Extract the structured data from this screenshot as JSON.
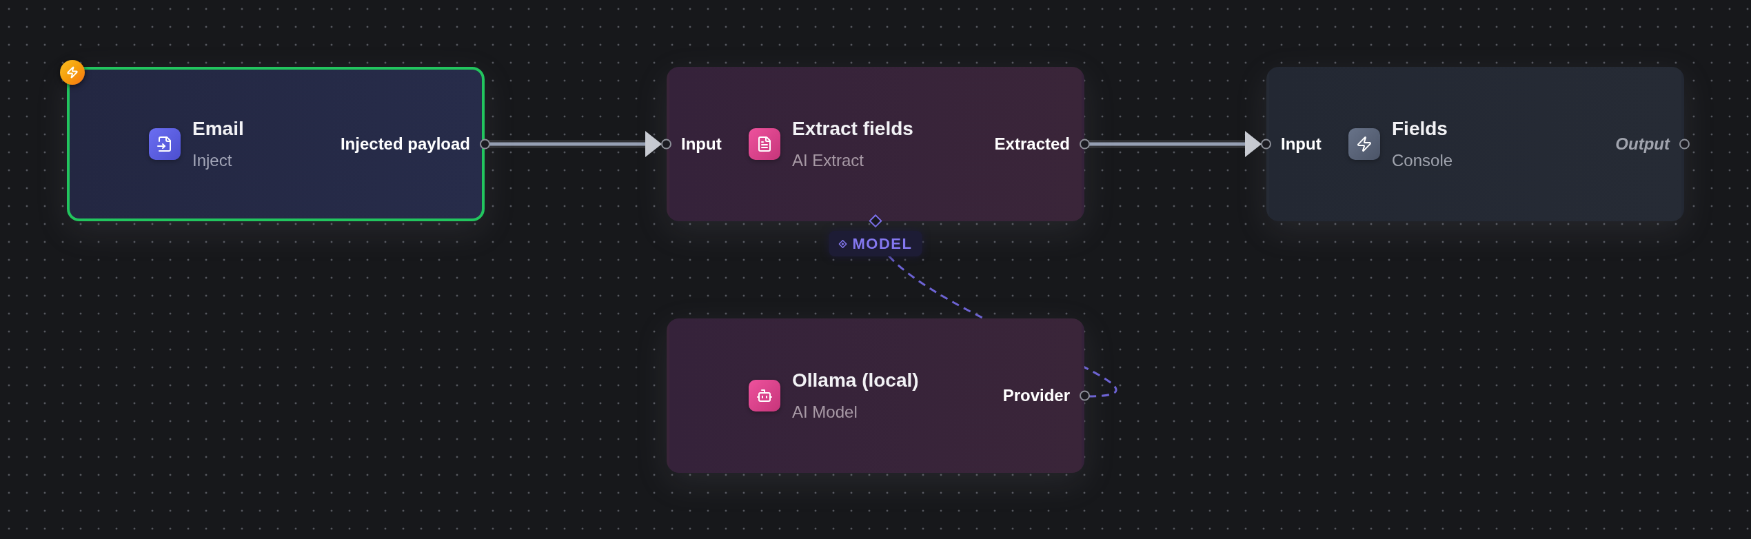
{
  "canvas": {
    "nodes": [
      {
        "kind": "inject",
        "title": "Email",
        "subtitle": "Inject",
        "selected": true,
        "trigger": true,
        "output": {
          "label": "Injected payload",
          "connected": true
        }
      },
      {
        "kind": "extract",
        "title": "Extract fields",
        "subtitle": "AI Extract",
        "selected": false,
        "trigger": false,
        "input": {
          "label": "Input",
          "connected": true
        },
        "output": {
          "label": "Extracted",
          "connected": true
        },
        "model_slot": {
          "label": "MODEL"
        }
      },
      {
        "kind": "console",
        "title": "Fields",
        "subtitle": "Console",
        "selected": false,
        "trigger": false,
        "input": {
          "label": "Input",
          "connected": true
        },
        "output": {
          "label": "Output",
          "connected": false
        }
      },
      {
        "kind": "model",
        "title": "Ollama (local)",
        "subtitle": "AI Model",
        "selected": false,
        "trigger": false,
        "output": {
          "label": "Provider",
          "connected": true
        }
      }
    ]
  }
}
